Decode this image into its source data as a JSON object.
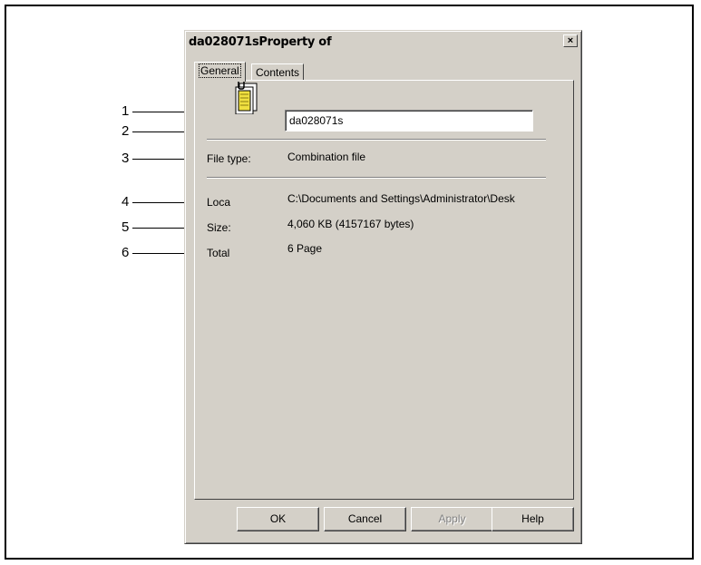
{
  "dialog": {
    "title": "da028071sProperty of",
    "close_label": "×",
    "tabs": [
      {
        "label": "General"
      },
      {
        "label": "Contents"
      }
    ],
    "filename_value": "da028071s",
    "file_icon": "combination-file-icon",
    "properties": [
      {
        "label": "File type:",
        "value": "Combination file"
      },
      {
        "label": "Loca",
        "value": "C:\\Documents and Settings\\Administrator\\Desk"
      },
      {
        "label": "Size:",
        "value": "4,060 KB (4157167 bytes)"
      },
      {
        "label": "Total",
        "value": "6 Page"
      }
    ],
    "buttons": {
      "ok": "OK",
      "cancel": "Cancel",
      "apply": "Apply",
      "help": "Help"
    }
  },
  "callouts": [
    "1",
    "2",
    "3",
    "4",
    "5",
    "6"
  ]
}
